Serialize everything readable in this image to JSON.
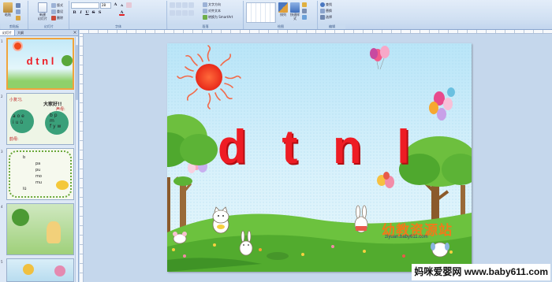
{
  "ribbon": {
    "groups": {
      "clipboard": "剪贴板",
      "slides": "幻灯片",
      "font": "字体",
      "paragraph": "段落",
      "drawing": "绘图",
      "editing": "编辑"
    },
    "paste": "粘贴",
    "new_slide": "新建\n幻灯片",
    "delete": "删除",
    "layout": "版式",
    "reset": "重设",
    "text_direction": "文字方向",
    "align_text": "对齐文本",
    "convert_smartart": "转换为 SmartArt",
    "arrange": "排列",
    "quick_styles": "快速样式",
    "shape_fill": "形状填充",
    "shape_outline": "形状轮廓",
    "shape_effects": "形状效果",
    "find": "查找",
    "replace": "替换",
    "select": "选择",
    "font_size": "28"
  },
  "panel": {
    "tab_slides": "幻灯片",
    "tab_outline": "大纲",
    "close": "×",
    "slide_numbers": [
      "1",
      "2",
      "3",
      "4",
      "5"
    ],
    "thumb1_title": "d t n l",
    "thumb2": {
      "review": "小复习,",
      "greeting": "大家好!!",
      "initials": "声母:",
      "finals": "韵母:",
      "vowels": "a o e\ni u ü",
      "consonants": "b p\nm\nf y w"
    },
    "thumb3": {
      "rows": [
        "b",
        "pa",
        "pu",
        "mo",
        "mu",
        "lū"
      ]
    }
  },
  "slide": {
    "title": "d t n l",
    "watermark_cn": "幼教资源站",
    "watermark_url": "ziyuan.baby611.com"
  },
  "footer_watermark": "妈咪爱婴网 www.baby611.com",
  "colors": {
    "title_red": "#ee1c24",
    "ribbon": "#cfdff2",
    "panel": "#dde8f6"
  }
}
